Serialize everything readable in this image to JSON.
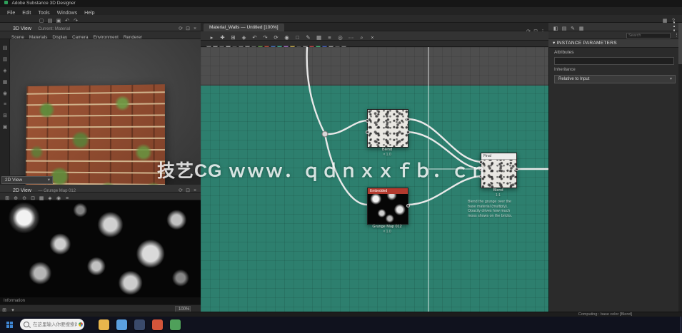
{
  "colors": {
    "accent_teal": "#2d7f6e",
    "node_alert": "#b23a2e",
    "wire": "#e9e9e9"
  },
  "icons": {
    "caret_down": "▾",
    "kebab": "⋮"
  },
  "window": {
    "title": "Adobe Substance 3D Designer",
    "menus": [
      "File",
      "Edit",
      "Tools",
      "Windows",
      "Help"
    ]
  },
  "main_toolbar": {
    "left_icons": [
      {
        "name": "new-file-icon",
        "glyph": "▢"
      },
      {
        "name": "open-file-icon",
        "glyph": "▤"
      },
      {
        "name": "save-icon",
        "glyph": "▣"
      },
      {
        "name": "undo-icon",
        "glyph": "↶"
      },
      {
        "name": "redo-icon",
        "glyph": "↷"
      }
    ],
    "right_icons": [
      {
        "name": "layout-icon",
        "glyph": "▦"
      },
      {
        "name": "help-icon",
        "glyph": "?"
      }
    ]
  },
  "left_panel": {
    "side_icons": [
      {
        "name": "library-icon",
        "glyph": "▤"
      },
      {
        "name": "explorer-icon",
        "glyph": "▥"
      },
      {
        "name": "graph-icon",
        "glyph": "◈"
      },
      {
        "name": "shelf-icon",
        "glyph": "▦"
      },
      {
        "name": "bake-icon",
        "glyph": "◉"
      },
      {
        "name": "settings-icon",
        "glyph": "≡"
      },
      {
        "name": "plugin-icon",
        "glyph": "⊞"
      },
      {
        "name": "log-icon",
        "glyph": "▣"
      }
    ],
    "view3d": {
      "title": "3D View",
      "context": "Current: Material",
      "menus": [
        "Scene",
        "Materials",
        "Display",
        "Camera",
        "Environment",
        "Renderer"
      ],
      "header_icons": [
        {
          "name": "refresh-icon",
          "glyph": "⟳"
        },
        {
          "name": "expand-icon",
          "glyph": "⊡"
        },
        {
          "name": "close-icon",
          "glyph": "×"
        }
      ]
    },
    "view2d": {
      "combo_label": "2D View",
      "title": "2D View",
      "context": "— Grunge Map 012",
      "header_icons": [
        {
          "name": "refresh-icon",
          "glyph": "⟳"
        },
        {
          "name": "expand-icon",
          "glyph": "⊡"
        },
        {
          "name": "close-icon",
          "glyph": "×"
        }
      ],
      "toolbar_icons": [
        {
          "name": "grid-icon",
          "glyph": "⊞"
        },
        {
          "name": "zoom-in-icon",
          "glyph": "⊕"
        },
        {
          "name": "zoom-out-icon",
          "glyph": "⊖"
        },
        {
          "name": "fit-icon",
          "glyph": "⊡"
        },
        {
          "name": "channels-icon",
          "glyph": "▦"
        },
        {
          "name": "tiling-icon",
          "glyph": "◈"
        },
        {
          "name": "info-icon",
          "glyph": "◉"
        },
        {
          "name": "options-icon",
          "glyph": "≡"
        }
      ],
      "info": "Information",
      "status_icons": [
        {
          "name": "grid-icon",
          "glyph": "⊞"
        },
        {
          "name": "caret-down-icon",
          "glyph": "▾"
        }
      ],
      "zoom": "100%"
    }
  },
  "graph": {
    "tab": "Material_Walls — Untitled [100%]",
    "toolbar_icons": [
      {
        "name": "select-icon",
        "glyph": "▸"
      },
      {
        "name": "add-node-icon",
        "glyph": "✚"
      },
      {
        "name": "grid-icon",
        "glyph": "⊞"
      },
      {
        "name": "snap-icon",
        "glyph": "◈"
      },
      {
        "name": "undo-icon",
        "glyph": "↶"
      },
      {
        "name": "redo-icon",
        "glyph": "↷"
      },
      {
        "name": "refresh-icon",
        "glyph": "⟳"
      },
      {
        "name": "view-icon",
        "glyph": "◉"
      },
      {
        "name": "frame-icon",
        "glyph": "□"
      },
      {
        "name": "comment-icon",
        "glyph": "✎"
      },
      {
        "name": "layers-icon",
        "glyph": "▦"
      },
      {
        "name": "list-icon",
        "glyph": "≡"
      },
      {
        "name": "pin-icon",
        "glyph": "◎"
      },
      {
        "name": "more-icon",
        "glyph": "⋯"
      },
      {
        "name": "search-icon",
        "glyph": "⌕"
      },
      {
        "name": "close-icon",
        "glyph": "×"
      }
    ],
    "tab_icons": [
      {
        "name": "refresh-icon",
        "glyph": "⟳"
      },
      {
        "name": "expand-icon",
        "glyph": "⊡"
      },
      {
        "name": "kebab-icon",
        "glyph": "⋮"
      }
    ],
    "swatches": [
      "#7d7d7d",
      "#8f8f8f",
      "#686868",
      "#a0a0a0",
      "#575757",
      "#747474",
      "#8a8a8a",
      "#616161",
      "#5f8c4a",
      "#b05040",
      "#4a6fb0",
      "#45a38e",
      "#9a70b8",
      "#b8a050",
      "#4f4f4f",
      "#828282",
      "#b04a4a",
      "#4ab07a",
      "#4a62b0",
      "#8f8f8f",
      "#5c5c5c",
      "#767676"
    ],
    "watermark": "技艺CG ｗｗｗ．ｑｄｎｘｘｆｂ．ｃｎ",
    "nodes": [
      {
        "label": "Blend",
        "sub": "× 1.0"
      },
      {
        "header": "Embedded",
        "label": "Grunge Map 012",
        "sub": "× 1.0"
      },
      {
        "header": "Final",
        "label": "Blend",
        "sub": "1:1",
        "note": [
          "Blend the grunge over the",
          "base material (multiply).",
          "Opacity drives how much",
          "moss shows on the bricks."
        ]
      }
    ]
  },
  "right_panel": {
    "header_icons": [
      {
        "name": "dock-icon",
        "glyph": "◧"
      },
      {
        "name": "list-icon",
        "glyph": "▤"
      },
      {
        "name": "edit-icon",
        "glyph": "✎"
      },
      {
        "name": "grid-icon",
        "glyph": "▦"
      }
    ],
    "search_placeholder": "Search",
    "section_title": "▾  INSTANCE PARAMETERS",
    "attributes_label": "Attributes",
    "identifier_value": "",
    "inheritance_label": "Inheritance",
    "inheritance_value": "Relative to Input"
  },
  "status_bar": {
    "text": "Computing : base color [Blend]"
  },
  "taskbar": {
    "search_placeholder": "在这里输入你要搜索的内容",
    "apps": [
      {
        "name": "file-explorer",
        "color": "#e8b64c"
      },
      {
        "name": "browser-edge",
        "color": "#5aa0e0"
      },
      {
        "name": "app-window",
        "color": "#3a4a6b"
      },
      {
        "name": "app-red",
        "color": "#d4553a"
      },
      {
        "name": "app-green",
        "color": "#4fa05a"
      }
    ]
  }
}
